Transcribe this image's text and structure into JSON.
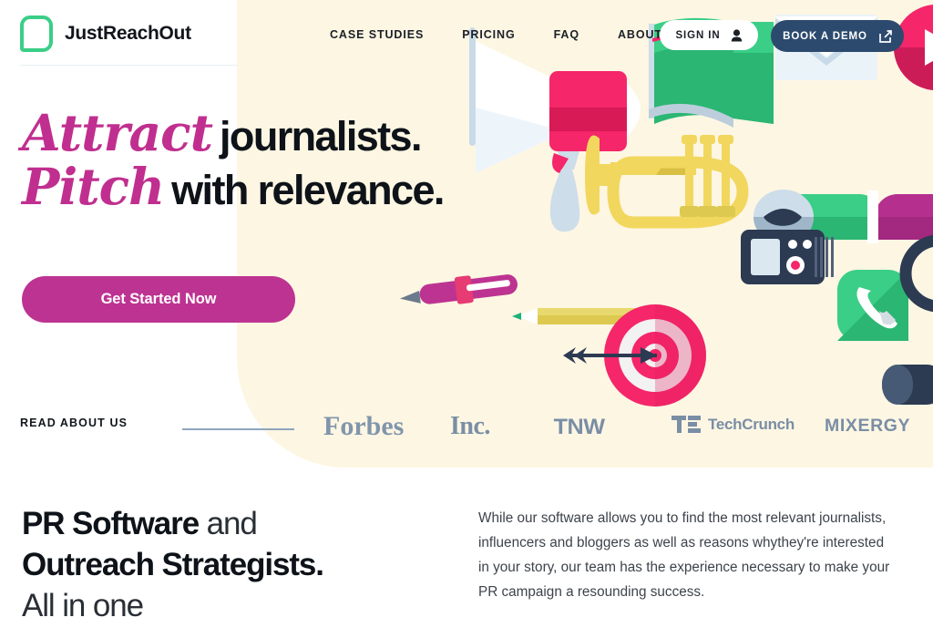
{
  "brand": {
    "name": "JustReachOut",
    "logo_icon": "rounded-square-outline-icon",
    "logo_color": "#3ace86"
  },
  "nav": {
    "items": [
      {
        "label": "CASE STUDIES"
      },
      {
        "label": "PRICING"
      },
      {
        "label": "FAQ"
      },
      {
        "label": "ABOUT"
      }
    ],
    "signin": {
      "label": "SIGN IN",
      "icon": "user-icon"
    },
    "demo": {
      "label": "BOOK A DEMO",
      "icon": "external-link-icon",
      "color": "#2c4a6e"
    }
  },
  "hero": {
    "line1_script": "Attract",
    "line1_bold": "journalists.",
    "line2_script": "Pitch",
    "line2_bold": "with relevance.",
    "script_color": "#c02f8f",
    "cta": {
      "label": "Get Started Now",
      "color": "#bd3391"
    },
    "background_color": "#fdf6e3"
  },
  "press": {
    "label": "READ ABOUT US",
    "logos": [
      {
        "name": "Forbes"
      },
      {
        "name": "Inc."
      },
      {
        "name": "TNW"
      },
      {
        "name": "TechCrunch"
      },
      {
        "name": "MIXERGY"
      }
    ],
    "logo_color": "#7a8ea5"
  },
  "lower": {
    "title_bold_1": "PR Software",
    "title_thin_1": " and",
    "title_bold_2": "Outreach Strategists.",
    "title_thin_2": "All in one",
    "paragraph": "While our software allows you to find the most relevant journalists, influencers and bloggers as well as reasons whythey're interested in your story, our team has the experience necessary to make your PR campaign a resounding success."
  },
  "illustration": {
    "items": [
      {
        "name": "megaphone-illustration",
        "color": "#f5266a"
      },
      {
        "name": "green-book-illustration",
        "color": "#2bb673"
      },
      {
        "name": "envelope-illustration",
        "color": "#dce8f0"
      },
      {
        "name": "play-button-illustration",
        "color": "#f5266a"
      },
      {
        "name": "rolled-newspaper-illustration",
        "color": "#b52f8f"
      },
      {
        "name": "magenta-pen-illustration",
        "color": "#bd3391"
      },
      {
        "name": "yellow-pencil-illustration",
        "color": "#e3d05a"
      },
      {
        "name": "trumpet-illustration",
        "color": "#f2d75e"
      },
      {
        "name": "target-arrow-illustration",
        "color": "#f5266a"
      },
      {
        "name": "voice-recorder-illustration",
        "color": "#2c3a52"
      },
      {
        "name": "phone-app-illustration",
        "color": "#2bb673"
      },
      {
        "name": "microphone-illustration",
        "color": "#2c3a52"
      }
    ]
  }
}
